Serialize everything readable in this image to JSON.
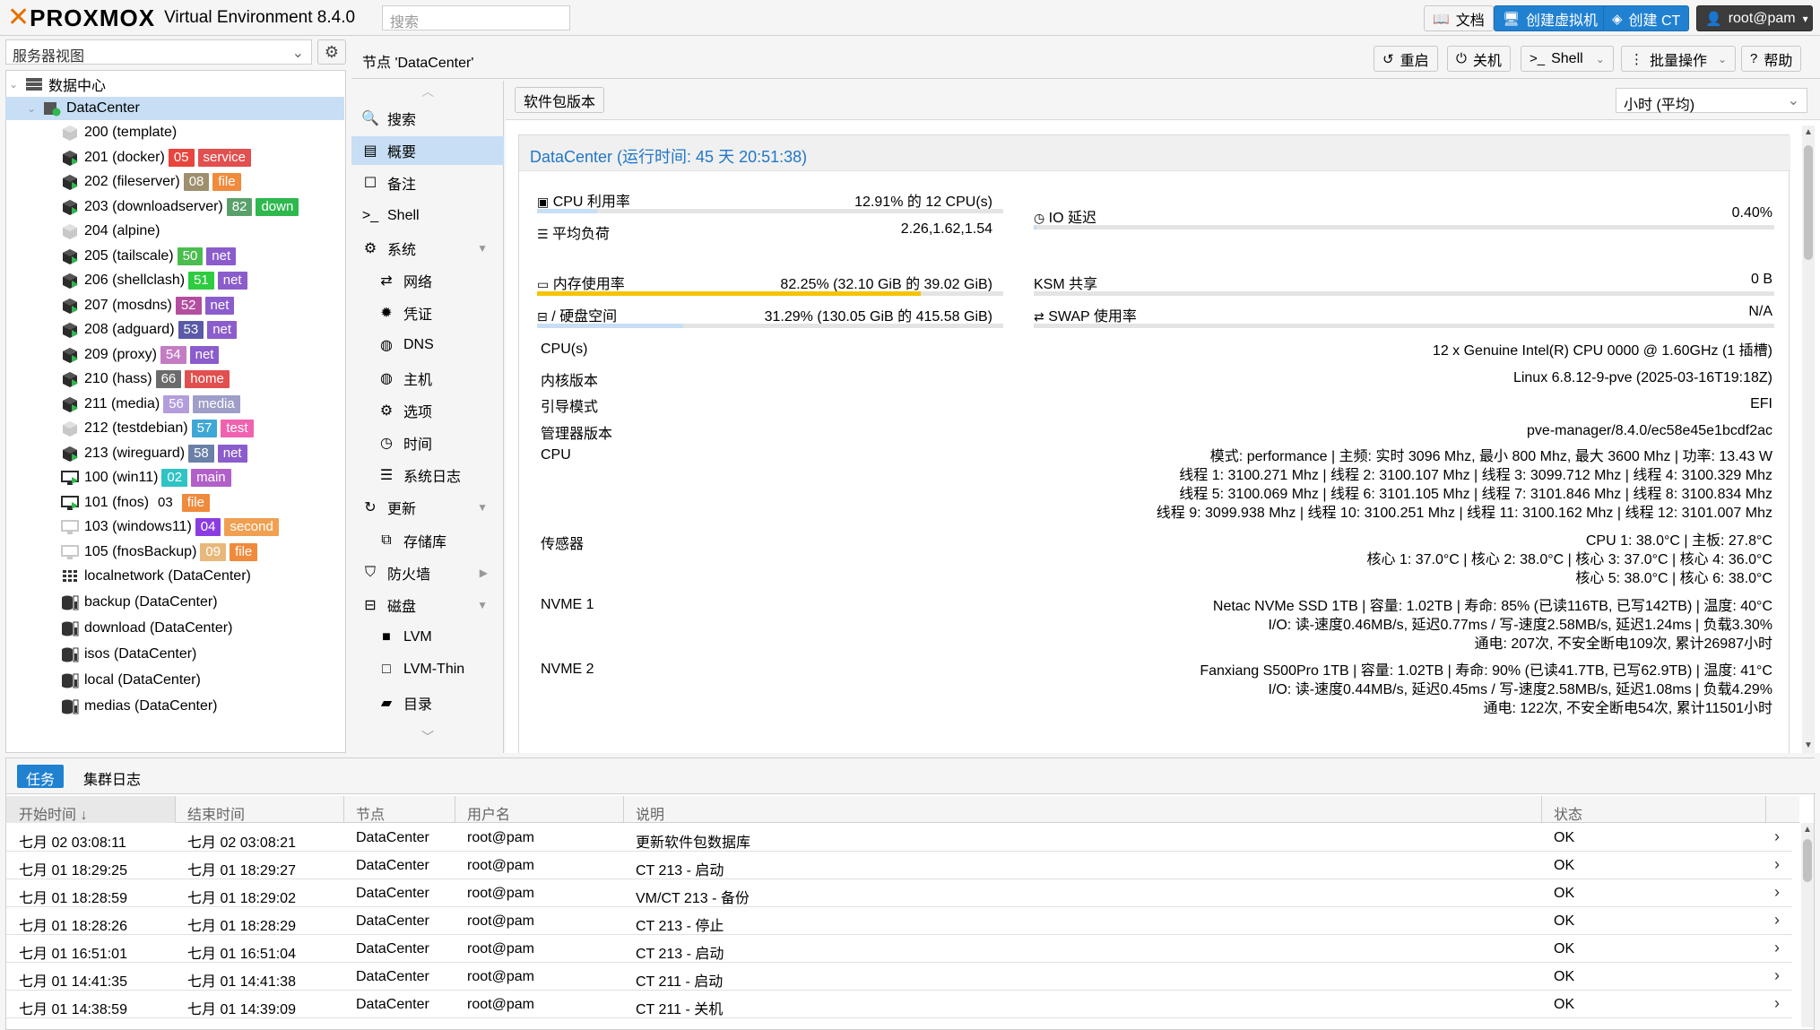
{
  "topbar": {
    "brand": "PROXMOX",
    "product": "Virtual Environment 8.4.0",
    "search_placeholder": "搜索",
    "docs": "文档",
    "create_vm": "创建虚拟机",
    "create_ct": "创建 CT",
    "user": "root@pam"
  },
  "tree": {
    "view": "服务器视图",
    "root": "数据中心",
    "node": "DataCenter",
    "items": [
      {
        "label": "200 (template)",
        "icon": "template-icon",
        "tags": []
      },
      {
        "label": "201 (docker)",
        "icon": "ct-running-icon",
        "tags": [
          {
            "text": "05",
            "color": "#e8453c"
          },
          {
            "text": "service",
            "color": "#e24f4f"
          }
        ]
      },
      {
        "label": "202 (fileserver)",
        "icon": "ct-running-icon",
        "tags": [
          {
            "text": "08",
            "color": "#9e8f6e"
          },
          {
            "text": "file",
            "color": "#f08a3c"
          }
        ]
      },
      {
        "label": "203 (downloadserver)",
        "icon": "ct-running-icon",
        "tags": [
          {
            "text": "82",
            "color": "#5aa06a"
          },
          {
            "text": "down",
            "color": "#2eb84e"
          }
        ]
      },
      {
        "label": "204 (alpine)",
        "icon": "ct-stopped-icon",
        "tags": []
      },
      {
        "label": "205 (tailscale)",
        "icon": "ct-running-icon",
        "tags": [
          {
            "text": "50",
            "color": "#4bbd4f"
          },
          {
            "text": "net",
            "color": "#8b5ccc"
          }
        ]
      },
      {
        "label": "206 (shellclash)",
        "icon": "ct-running-icon",
        "tags": [
          {
            "text": "51",
            "color": "#2ecc40"
          },
          {
            "text": "net",
            "color": "#8b5ccc"
          }
        ]
      },
      {
        "label": "207 (mosdns)",
        "icon": "ct-running-icon",
        "tags": [
          {
            "text": "52",
            "color": "#b44ea0"
          },
          {
            "text": "net",
            "color": "#8b5ccc"
          }
        ]
      },
      {
        "label": "208 (adguard)",
        "icon": "ct-running-icon",
        "tags": [
          {
            "text": "53",
            "color": "#5a5aa8"
          },
          {
            "text": "net",
            "color": "#8b5ccc"
          }
        ]
      },
      {
        "label": "209 (proxy)",
        "icon": "ct-running-icon",
        "tags": [
          {
            "text": "54",
            "color": "#c47cc4"
          },
          {
            "text": "net",
            "color": "#8b5ccc"
          }
        ]
      },
      {
        "label": "210 (hass)",
        "icon": "ct-running-icon",
        "tags": [
          {
            "text": "66",
            "color": "#6b6b6b"
          },
          {
            "text": "home",
            "color": "#e24f4f"
          }
        ]
      },
      {
        "label": "211 (media)",
        "icon": "ct-running-icon",
        "tags": [
          {
            "text": "56",
            "color": "#b39ddb"
          },
          {
            "text": "media",
            "color": "#9e9ec8"
          }
        ]
      },
      {
        "label": "212 (testdebian)",
        "icon": "ct-stopped-icon",
        "tags": [
          {
            "text": "57",
            "color": "#3fa7d6"
          },
          {
            "text": "test",
            "color": "#f062b0"
          }
        ]
      },
      {
        "label": "213 (wireguard)",
        "icon": "ct-running-icon",
        "tags": [
          {
            "text": "58",
            "color": "#6a80a8"
          },
          {
            "text": "net",
            "color": "#8b5ccc"
          }
        ]
      },
      {
        "label": "100 (win11)",
        "icon": "vm-running-icon",
        "tags": [
          {
            "text": "02",
            "color": "#2ec4c4"
          },
          {
            "text": "main",
            "color": "#b060c8"
          }
        ]
      },
      {
        "label": "101 (fnos)",
        "icon": "vm-running-icon",
        "tags": [
          {
            "text": "03",
            "color": "#ffffff"
          },
          {
            "text": "file",
            "color": "#f08a3c"
          }
        ]
      },
      {
        "label": "103 (windows11)",
        "icon": "vm-stopped-icon",
        "tags": [
          {
            "text": "04",
            "color": "#8b3ce0"
          },
          {
            "text": "second",
            "color": "#f0a050"
          }
        ]
      },
      {
        "label": "105 (fnosBackup)",
        "icon": "vm-stopped-icon",
        "tags": [
          {
            "text": "09",
            "color": "#e8b87a"
          },
          {
            "text": "file",
            "color": "#f08a3c"
          }
        ]
      },
      {
        "label": "localnetwork (DataCenter)",
        "icon": "network-icon",
        "tags": []
      },
      {
        "label": "backup (DataCenter)",
        "icon": "storage-icon",
        "tags": []
      },
      {
        "label": "download (DataCenter)",
        "icon": "storage-icon",
        "tags": []
      },
      {
        "label": "isos (DataCenter)",
        "icon": "storage-icon",
        "tags": []
      },
      {
        "label": "local (DataCenter)",
        "icon": "storage-icon",
        "tags": []
      },
      {
        "label": "medias (DataCenter)",
        "icon": "storage-icon",
        "tags": []
      }
    ]
  },
  "node_header": {
    "title": "节点 'DataCenter'",
    "reboot": "重启",
    "shutdown": "关机",
    "shell": "Shell",
    "bulk": "批量操作",
    "help": "帮助"
  },
  "menu": [
    {
      "label": "搜索",
      "icon": "search-icon",
      "glyph": "🔍"
    },
    {
      "label": "概要",
      "icon": "summary-icon",
      "glyph": "▤",
      "selected": true
    },
    {
      "label": "备注",
      "icon": "notes-icon",
      "glyph": "☐"
    },
    {
      "label": "Shell",
      "icon": "terminal-icon",
      "glyph": ">_"
    },
    {
      "label": "系统",
      "icon": "system-icon",
      "glyph": "⚙",
      "expand": true
    },
    {
      "label": "网络",
      "icon": "network-icon",
      "glyph": "⇄",
      "indent": true
    },
    {
      "label": "凭证",
      "icon": "certificate-icon",
      "glyph": "✹",
      "indent": true
    },
    {
      "label": "DNS",
      "icon": "globe-icon",
      "glyph": "◍",
      "indent": true
    },
    {
      "label": "主机",
      "icon": "hosts-icon",
      "glyph": "◍",
      "indent": true
    },
    {
      "label": "选项",
      "icon": "options-icon",
      "glyph": "⚙",
      "indent": true
    },
    {
      "label": "时间",
      "icon": "clock-icon",
      "glyph": "◷",
      "indent": true
    },
    {
      "label": "系统日志",
      "icon": "list-icon",
      "glyph": "☰",
      "indent": true
    },
    {
      "label": "更新",
      "icon": "refresh-icon",
      "glyph": "↻",
      "expand": true
    },
    {
      "label": "存储库",
      "icon": "repository-icon",
      "glyph": "⧉",
      "indent": true
    },
    {
      "label": "防火墙",
      "icon": "shield-icon",
      "glyph": "⛉",
      "arrow": true
    },
    {
      "label": "磁盘",
      "icon": "disk-icon",
      "glyph": "⊟",
      "expand": true
    },
    {
      "label": "LVM",
      "icon": "lvm-icon",
      "glyph": "■",
      "indent": true
    },
    {
      "label": "LVM-Thin",
      "icon": "lvm-thin-icon",
      "glyph": "□",
      "indent": true
    },
    {
      "label": "目录",
      "icon": "folder-icon",
      "glyph": "▰",
      "indent": true
    }
  ],
  "content": {
    "pkg_versions": "软件包版本",
    "timeframe": "小时 (平均)",
    "summary_title": "DataCenter (运行时间: 45 天 20:51:38)",
    "stats": {
      "cpu_label": "CPU 利用率",
      "cpu_value": "12.91% 的 12 CPU(s)",
      "cpu_pct": 0.1291,
      "load_label": "平均负荷",
      "load_value": "2.26,1.62,1.54",
      "io_label": "IO 延迟",
      "io_value": "0.40%",
      "io_pct": 0.004,
      "mem_label": "内存使用率",
      "mem_value": "82.25% (32.10 GiB 的 39.02 GiB)",
      "mem_pct": 0.8225,
      "ksm_label": "KSM 共享",
      "ksm_value": "0 B",
      "disk_label": "/ 硬盘空间",
      "disk_value": "31.29% (130.05 GiB 的 415.58 GiB)",
      "disk_pct": 0.3129,
      "swap_label": "SWAP 使用率",
      "swap_value": "N/A"
    },
    "info": [
      {
        "key": "CPU(s)",
        "lines": [
          "12 x Genuine Intel(R) CPU 0000 @ 1.60GHz (1 插槽)"
        ]
      },
      {
        "key": "内核版本",
        "lines": [
          "Linux 6.8.12-9-pve (2025-03-16T19:18Z)"
        ]
      },
      {
        "key": "引导模式",
        "lines": [
          "EFI"
        ]
      },
      {
        "key": "管理器版本",
        "lines": [
          "pve-manager/8.4.0/ec58e45e1bcdf2ac"
        ]
      },
      {
        "key": "CPU",
        "lines": [
          "模式: performance | 主频: 实时 3096 Mhz, 最小 800 Mhz, 最大 3600 Mhz | 功率: 13.43 W",
          "线程 1: 3100.271 Mhz | 线程 2: 3100.107 Mhz | 线程 3: 3099.712 Mhz | 线程 4: 3100.329 Mhz",
          "线程 5: 3100.069 Mhz | 线程 6: 3101.105 Mhz | 线程 7: 3101.846 Mhz | 线程 8: 3100.834 Mhz",
          "线程 9: 3099.938 Mhz | 线程 10: 3100.251 Mhz | 线程 11: 3100.162 Mhz | 线程 12: 3101.007 Mhz"
        ]
      },
      {
        "key": "传感器",
        "lines": [
          "CPU 1: 38.0°C | 主板: 27.8°C",
          "核心 1: 37.0°C | 核心 2: 38.0°C | 核心 3: 37.0°C | 核心 4: 36.0°C",
          "核心 5: 38.0°C | 核心 6: 38.0°C"
        ]
      },
      {
        "key": "NVME 1",
        "lines": [
          "Netac NVMe SSD 1TB | 容量: 1.02TB | 寿命: 85% (已读116TB, 已写142TB) | 温度: 40°C",
          "I/O: 读-速度0.46MB/s, 延迟0.77ms / 写-速度2.58MB/s, 延迟1.24ms | 负载3.30%",
          "通电: 207次, 不安全断电109次, 累计26987小时"
        ]
      },
      {
        "key": "NVME 2",
        "lines": [
          "Fanxiang S500Pro 1TB | 容量: 1.02TB | 寿命: 90% (已读41.7TB, 已写62.9TB) | 温度: 41°C",
          "I/O: 读-速度0.44MB/s, 延迟0.45ms / 写-速度2.58MB/s, 延迟1.08ms | 负载4.29%",
          "通电: 122次, 不安全断电54次, 累计11501小时"
        ]
      }
    ]
  },
  "log": {
    "tabs": [
      "任务",
      "集群日志"
    ],
    "columns": [
      "开始时间 ↓",
      "结束时间",
      "节点",
      "用户名",
      "说明",
      "状态"
    ],
    "rows": [
      [
        "七月 02 03:08:11",
        "七月 02 03:08:21",
        "DataCenter",
        "root@pam",
        "更新软件包数据库",
        "OK"
      ],
      [
        "七月 01 18:29:25",
        "七月 01 18:29:27",
        "DataCenter",
        "root@pam",
        "CT 213 - 启动",
        "OK"
      ],
      [
        "七月 01 18:28:59",
        "七月 01 18:29:02",
        "DataCenter",
        "root@pam",
        "VM/CT 213 - 备份",
        "OK"
      ],
      [
        "七月 01 18:28:26",
        "七月 01 18:28:29",
        "DataCenter",
        "root@pam",
        "CT 213 - 停止",
        "OK"
      ],
      [
        "七月 01 16:51:01",
        "七月 01 16:51:04",
        "DataCenter",
        "root@pam",
        "CT 213 - 启动",
        "OK"
      ],
      [
        "七月 01 14:41:35",
        "七月 01 14:41:38",
        "DataCenter",
        "root@pam",
        "CT 211 - 启动",
        "OK"
      ],
      [
        "七月 01 14:38:59",
        "七月 01 14:39:09",
        "DataCenter",
        "root@pam",
        "CT 211 - 关机",
        "OK"
      ]
    ]
  }
}
